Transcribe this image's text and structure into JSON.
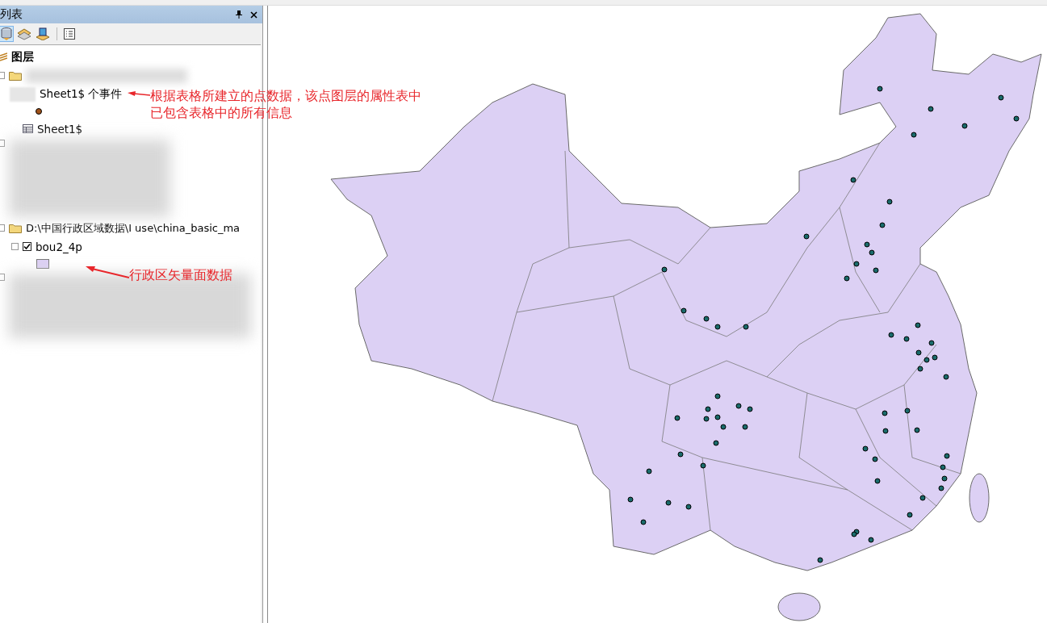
{
  "panel": {
    "title": "列表"
  },
  "tree": [
    {
      "kind": "root",
      "label": "图层"
    },
    {
      "kind": "folder"
    },
    {
      "kind": "layer",
      "label": "Sheet1$ 个事件"
    },
    {
      "kind": "point-symbol"
    },
    {
      "kind": "table",
      "label": "Sheet1$"
    },
    {
      "kind": "blurred"
    },
    {
      "kind": "folder",
      "label": "D:\\中国行政区域数据\\I use\\china_basic_ma"
    },
    {
      "kind": "checked-layer",
      "label": "bou2_4p",
      "checked": true
    },
    {
      "kind": "polygon-symbol"
    },
    {
      "kind": "blurred"
    }
  ],
  "annotations": [
    {
      "lines": [
        "根据表格所建立的点数据，该点图层的属性表中",
        "已包含表格中的所有信息"
      ]
    },
    {
      "lines": [
        "行政区矢量面数据"
      ]
    }
  ]
}
